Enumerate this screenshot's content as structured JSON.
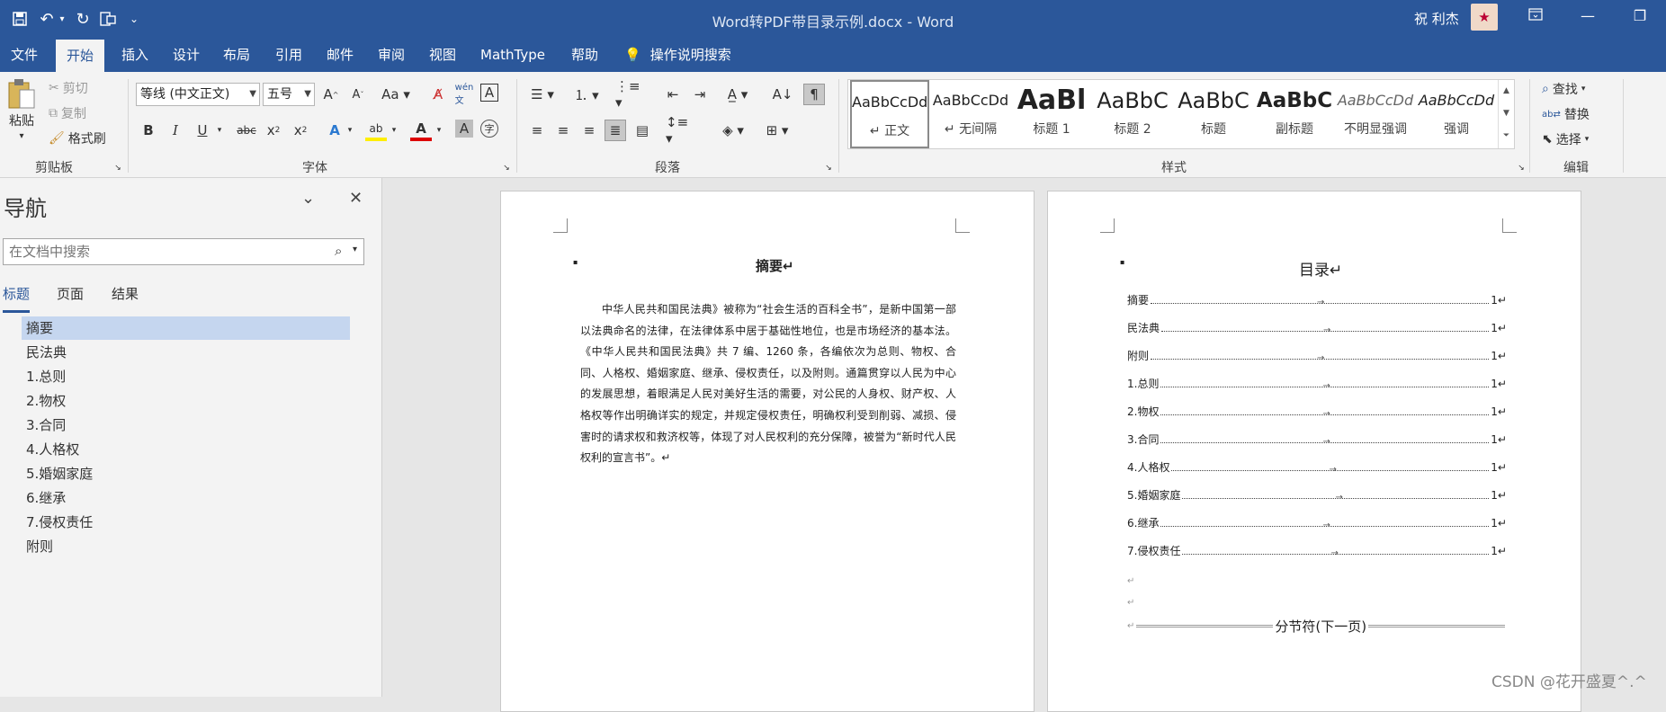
{
  "window": {
    "title": "Word转PDF带目录示例.docx  -  Word",
    "user": "祝 利杰"
  },
  "tabs": [
    "文件",
    "开始",
    "插入",
    "设计",
    "布局",
    "引用",
    "邮件",
    "审阅",
    "视图",
    "MathType",
    "帮助"
  ],
  "tell_me": "操作说明搜索",
  "ribbon": {
    "clipboard": {
      "paste": "粘贴",
      "cut": "剪切",
      "copy": "复制",
      "format_painter": "格式刷",
      "label": "剪贴板"
    },
    "font": {
      "name": "等线 (中文正文)",
      "size": "五号",
      "label": "字体"
    },
    "paragraph": {
      "label": "段落"
    },
    "styles": {
      "label": "样式",
      "items": [
        {
          "preview": "AaBbCcDd",
          "name": "↵ 正文"
        },
        {
          "preview": "AaBbCcDd",
          "name": "↵ 无间隔"
        },
        {
          "preview": "AaBl",
          "name": "标题 1"
        },
        {
          "preview": "AaBbC",
          "name": "标题 2"
        },
        {
          "preview": "AaBbC",
          "name": "标题"
        },
        {
          "preview": "AaBbC",
          "name": "副标题"
        },
        {
          "preview": "AaBbCcDd",
          "name": "不明显强调"
        },
        {
          "preview": "AaBbCcDd",
          "name": "强调"
        }
      ]
    },
    "editing": {
      "find": "查找",
      "replace": "替换",
      "select": "选择",
      "label": "编辑"
    }
  },
  "nav": {
    "title": "导航",
    "search_placeholder": "在文档中搜索",
    "tabs": [
      "标题",
      "页面",
      "结果"
    ],
    "headings": [
      "摘要",
      "民法典",
      "1.总则",
      "2.物权",
      "3.合同",
      "4.人格权",
      "5.婚姻家庭",
      "6.继承",
      "7.侵权责任",
      "附则"
    ]
  },
  "page1": {
    "title": "摘要↵",
    "body": "中华人民共和国民法典》被称为“社会生活的百科全书”，是新中国第一部以法典命名的法律，在法律体系中居于基础性地位，也是市场经济的基本法。《中华人民共和国民法典》共 7 编、1260 条，各编依次为总则、物权、合同、人格权、婚姻家庭、继承、侵权责任，以及附则。通篇贯穿以人民为中心的发展思想，着眼满足人民对美好生活的需要，对公民的人身权、财产权、人格权等作出明确详实的规定，并规定侵权责任，明确权利受到削弱、减损、侵害时的请求权和救济权等，体现了对人民权利的充分保障，被誉为“新时代人民权利的宣言书”。↵"
  },
  "page2": {
    "title": "目录↵",
    "toc": [
      {
        "label": "摘要",
        "page": "1↵"
      },
      {
        "label": "民法典",
        "page": "1↵"
      },
      {
        "label": "附则",
        "page": "1↵"
      },
      {
        "label": "1.总则",
        "page": "1↵"
      },
      {
        "label": "2.物权",
        "page": "1↵"
      },
      {
        "label": "3.合同",
        "page": "1↵"
      },
      {
        "label": "4.人格权",
        "page": "1↵"
      },
      {
        "label": "5.婚姻家庭",
        "page": "1↵"
      },
      {
        "label": "6.继承",
        "page": "1↵"
      },
      {
        "label": "7.侵权责任",
        "page": "1↵"
      }
    ],
    "section_break": "分节符(下一页)"
  },
  "watermark": "CSDN @花开盛夏^.^"
}
